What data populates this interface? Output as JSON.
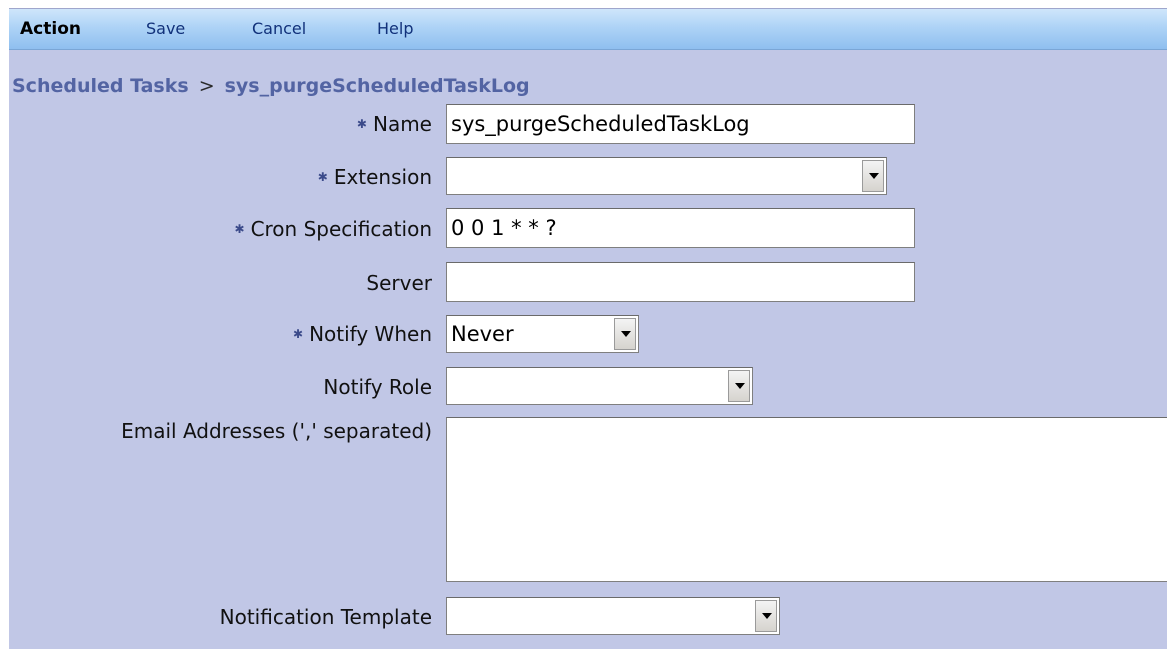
{
  "toolbar": {
    "action_label": "Action",
    "save_label": "Save",
    "cancel_label": "Cancel",
    "help_label": "Help"
  },
  "breadcrumb": {
    "parent": "Scheduled Tasks",
    "separator": ">",
    "current": "sys_purgeScheduledTaskLog"
  },
  "form": {
    "name": {
      "label": "Name",
      "value": "sys_purgeScheduledTaskLog",
      "required": true
    },
    "extension": {
      "label": "Extension",
      "value": "",
      "required": true
    },
    "cron": {
      "label": "Cron Specification",
      "value": "0 0 1 * * ?",
      "required": true
    },
    "server": {
      "label": "Server",
      "value": "",
      "required": false
    },
    "notify_when": {
      "label": "Notify When",
      "value": "Never",
      "required": true
    },
    "notify_role": {
      "label": "Notify Role",
      "value": "",
      "required": false
    },
    "emails": {
      "label": "Email Addresses (',' separated)",
      "value": "",
      "required": false
    },
    "template": {
      "label": "Notification Template",
      "value": "",
      "required": false
    }
  },
  "colors": {
    "form_background": "#c1c7e6",
    "toolbar_gradient_top": "#cfe6fb",
    "toolbar_gradient_bottom": "#8fbfef",
    "breadcrumb": "#5364a3"
  },
  "icons": {
    "required": "asterisk-icon",
    "dropdown": "chevron-down-icon"
  }
}
